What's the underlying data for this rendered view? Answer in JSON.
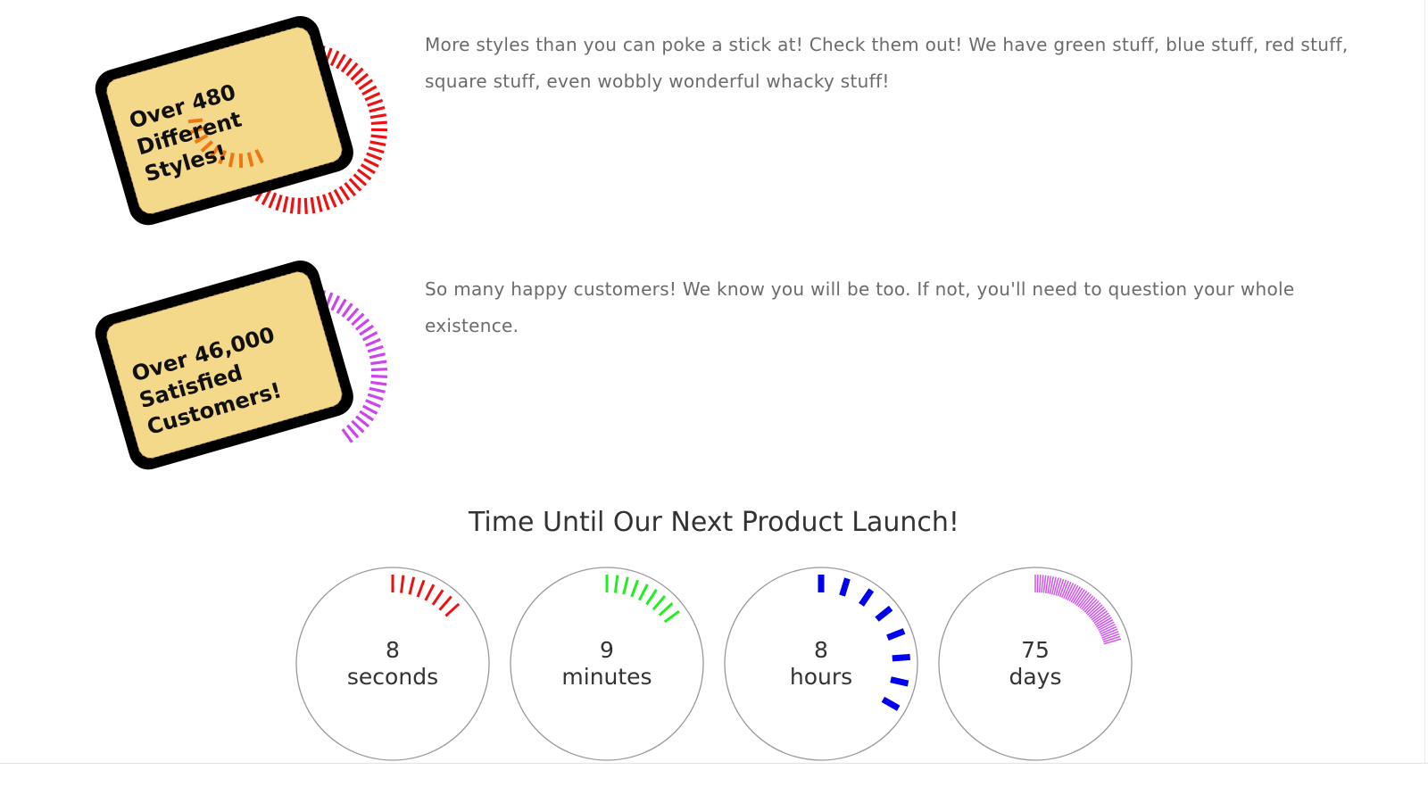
{
  "features": [
    {
      "badge_lines": [
        "Over 480",
        "Different",
        "Styles!"
      ],
      "description": "More styles than you can poke a stick at! Check them out! We have green stuff, blue stuff, red stuff, square stuff, even wobbly wonderful whacky stuff!",
      "ring_color": "#ee1111",
      "ring_level": 0.8,
      "inner_color": "#ee7711"
    },
    {
      "badge_lines": [
        "Over 46,000",
        "Satisfied",
        "Customers!"
      ],
      "description": "So many happy customers! We know you will be too. If not, you'll need to question your whole existence.",
      "ring_color": "#cc44ee",
      "ring_level": 0.4
    }
  ],
  "countdown": {
    "title": "Time Until Our Next Product Launch!",
    "units": [
      {
        "value": "8",
        "label": "seconds",
        "color": "#ee1111",
        "level": 0.133,
        "icon": "tick-ring"
      },
      {
        "value": "9",
        "label": "minutes",
        "color": "#22ee22",
        "level": 0.15,
        "icon": "tick-ring"
      },
      {
        "value": "8",
        "label": "hours",
        "color": "#0000ee",
        "level": 0.333,
        "icon": "tick-ring"
      },
      {
        "value": "75",
        "label": "days",
        "color": "#cc55ee",
        "level": 0.205,
        "icon": "tick-ring"
      }
    ]
  }
}
